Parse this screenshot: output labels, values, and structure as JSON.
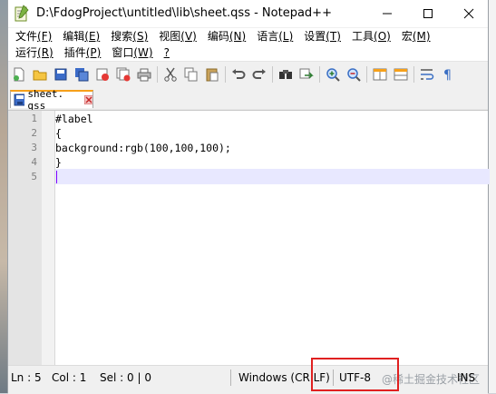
{
  "window": {
    "title": "D:\\FdogProject\\untitled\\lib\\sheet.qss - Notepad++"
  },
  "menu": {
    "row1": [
      {
        "label": "文件",
        "key": "(F)"
      },
      {
        "label": "编辑",
        "key": "(E)"
      },
      {
        "label": "搜索",
        "key": "(S)"
      },
      {
        "label": "视图",
        "key": "(V)"
      },
      {
        "label": "编码",
        "key": "(N)"
      },
      {
        "label": "语言",
        "key": "(L)"
      },
      {
        "label": "设置",
        "key": "(T)"
      },
      {
        "label": "工具",
        "key": "(O)"
      },
      {
        "label": "宏",
        "key": "(M)"
      }
    ],
    "row2": [
      {
        "label": "运行",
        "key": "(R)"
      },
      {
        "label": "插件",
        "key": "(P)"
      },
      {
        "label": "窗口",
        "key": "(W)"
      },
      {
        "label": "",
        "key": "?"
      }
    ]
  },
  "toolbar": {
    "icons": [
      "new-file-icon",
      "open-file-icon",
      "save-icon",
      "save-all-icon",
      "close-icon",
      "close-all-icon",
      "print-icon",
      "cut-icon",
      "copy-icon",
      "paste-icon",
      "undo-icon",
      "redo-icon",
      "find-icon",
      "replace-icon",
      "zoom-in-icon",
      "zoom-out-icon",
      "sync-scroll-icon",
      "word-wrap-icon",
      "show-all-chars-icon"
    ]
  },
  "tab": {
    "label": "sheet. qss"
  },
  "editor": {
    "lines": [
      {
        "num": "1",
        "text": "#label"
      },
      {
        "num": "2",
        "text": "{"
      },
      {
        "num": "3",
        "text": "background:rgb(100,100,100);"
      },
      {
        "num": "4",
        "text": "}"
      },
      {
        "num": "5",
        "text": ""
      }
    ]
  },
  "status": {
    "ln": "Ln : 5",
    "col": "Col : 1",
    "sel": "Sel : 0 | 0",
    "eol": "Windows (CR LF)",
    "encoding": "UTF-8",
    "mode": "INS",
    "watermark": "@稀土掘金技术社区"
  },
  "colors": {
    "tab_accent": "#f6a01a",
    "current_line": "#e8e8ff",
    "highlight_box": "#e02020"
  }
}
